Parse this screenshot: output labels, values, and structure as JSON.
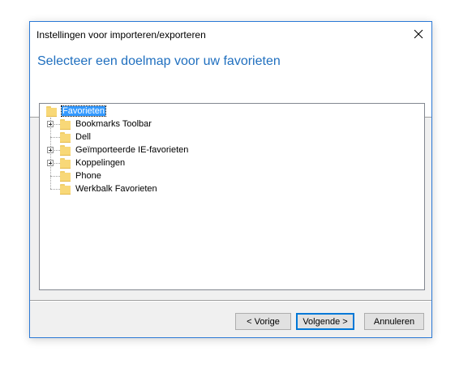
{
  "window": {
    "title": "Instellingen voor importeren/exporteren",
    "close_icon": "close-icon"
  },
  "header": {
    "heading": "Selecteer een doelmap voor uw favorieten"
  },
  "tree": {
    "root": {
      "label": "Favorieten",
      "selected": true,
      "icon": "folder-icon"
    },
    "children": [
      {
        "label": "Bookmarks Toolbar",
        "expandable": true,
        "icon": "folder-icon"
      },
      {
        "label": "Dell",
        "expandable": false,
        "icon": "folder-icon"
      },
      {
        "label": "Geïmporteerde IE-favorieten",
        "expandable": true,
        "icon": "folder-icon"
      },
      {
        "label": "Koppelingen",
        "expandable": true,
        "icon": "folder-icon"
      },
      {
        "label": "Phone",
        "expandable": false,
        "icon": "folder-icon"
      },
      {
        "label": "Werkbalk Favorieten",
        "expandable": false,
        "icon": "folder-icon"
      }
    ]
  },
  "buttons": {
    "back": "< Vorige",
    "next": "Volgende >",
    "cancel": "Annuleren"
  },
  "colors": {
    "accent": "#1f6fbf",
    "selection": "#3399ff",
    "window_border": "#2b79d6"
  }
}
